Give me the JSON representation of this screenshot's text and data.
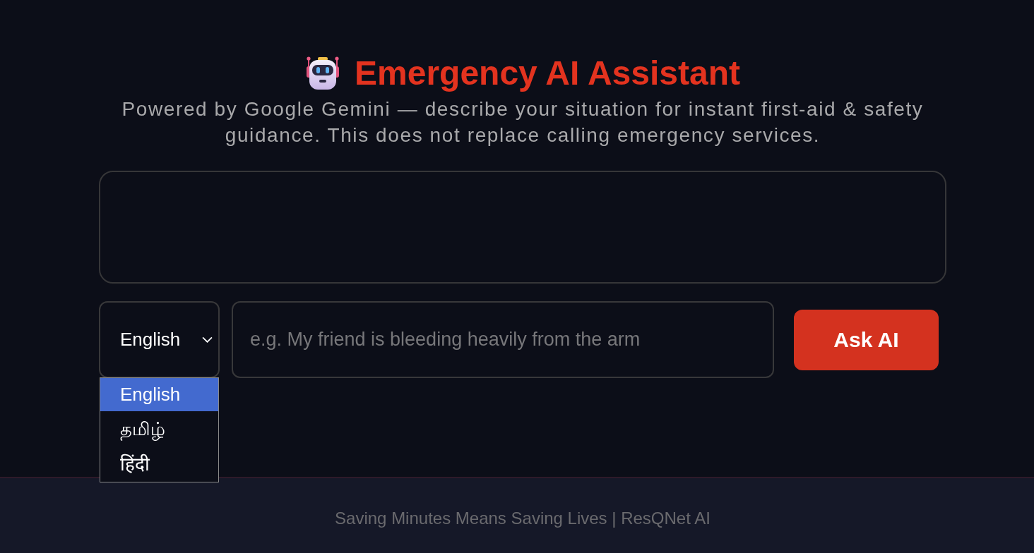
{
  "header": {
    "title": "Emergency AI Assistant",
    "subtitle": "Powered by Google Gemini — describe your situation for instant first-aid & safety guidance. This does not replace calling emergency services."
  },
  "language_select": {
    "value": "English",
    "expanded": true,
    "options": [
      {
        "label": "English",
        "selected": true
      },
      {
        "label": "தமிழ்",
        "selected": false
      },
      {
        "label": "हिंदी",
        "selected": false
      }
    ]
  },
  "query_input": {
    "placeholder": "e.g. My friend is bleeding heavily from the arm"
  },
  "ask_button": {
    "label": "Ask AI"
  },
  "footer": {
    "text": "Saving Minutes Means Saving Lives | ResQNet AI"
  }
}
